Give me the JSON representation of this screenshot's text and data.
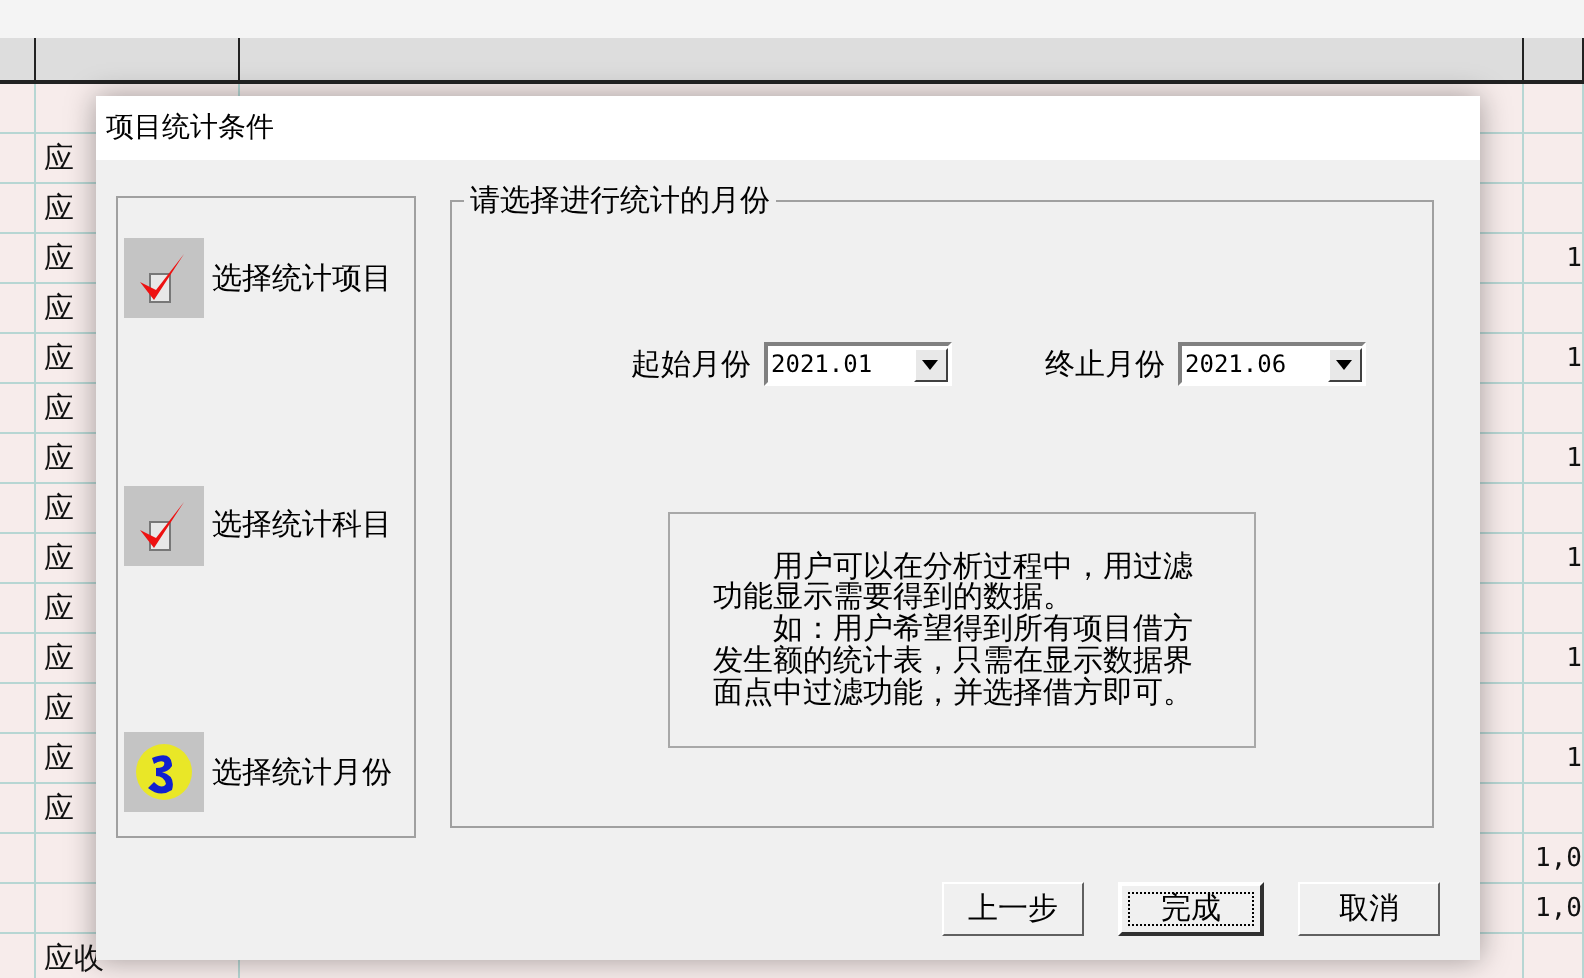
{
  "background_table": {
    "rows": [
      {},
      {
        "column_1": "应"
      },
      {
        "column_1": "应"
      },
      {
        "column_1": "应",
        "column_3": "1"
      },
      {
        "column_1": "应"
      },
      {
        "column_1": "应",
        "column_3": "1"
      },
      {
        "column_1": "应"
      },
      {
        "column_1": "应",
        "column_3": "1"
      },
      {
        "column_1": "应"
      },
      {
        "column_1": "应",
        "column_3": "1"
      },
      {
        "column_1": "应"
      },
      {
        "column_1": "应",
        "column_3": "1"
      },
      {
        "column_1": "应"
      },
      {
        "column_1": "应",
        "column_3": "1"
      },
      {
        "column_1": "应"
      },
      {
        "column_3": "1,0"
      },
      {
        "column_3": "1,0"
      },
      {
        "column_1": "应收"
      }
    ]
  },
  "dialog": {
    "title": "项目统计条件",
    "steps": [
      {
        "label": "选择统计项目",
        "kind": "done"
      },
      {
        "label": "选择统计科目",
        "kind": "done"
      },
      {
        "label": "选择统计月份",
        "kind": "current"
      }
    ],
    "group_title": "请选择进行统计的月份",
    "selects": [
      {
        "label": "起始月份",
        "value": "2021.01"
      },
      {
        "label": "终止月份",
        "value": "2021.06"
      }
    ],
    "info": [
      "用户可以在分析过程中，用过滤功能显示需要得到的数据。",
      "如：用户希望得到所有项目借方发生额的统计表，只需在显示数据界面点中过滤功能，并选择借方即可。"
    ],
    "buttons": [
      {
        "label": "上一步",
        "default": false
      },
      {
        "label": "完成",
        "default": true
      },
      {
        "label": "取消",
        "default": false
      }
    ]
  }
}
